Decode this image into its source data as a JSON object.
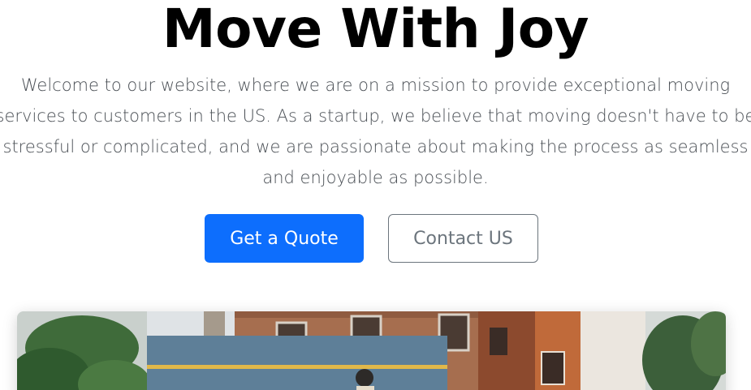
{
  "hero": {
    "title": "Move With Joy",
    "lead": "Welcome to our website, where we are on a mission to provide exceptional moving services to customers in the US. As a startup, we believe that moving doesn't have to be stressful or complicated, and we are passionate about making the process as seamless and enjoyable as possible.",
    "primary_button": "Get a Quote",
    "secondary_button": "Contact US"
  },
  "colors": {
    "primary": "#0d6efd",
    "secondary": "#6c757d",
    "text": "#000000"
  },
  "image": {
    "subject": "moving truck parked in front of brownstone buildings with trees"
  }
}
